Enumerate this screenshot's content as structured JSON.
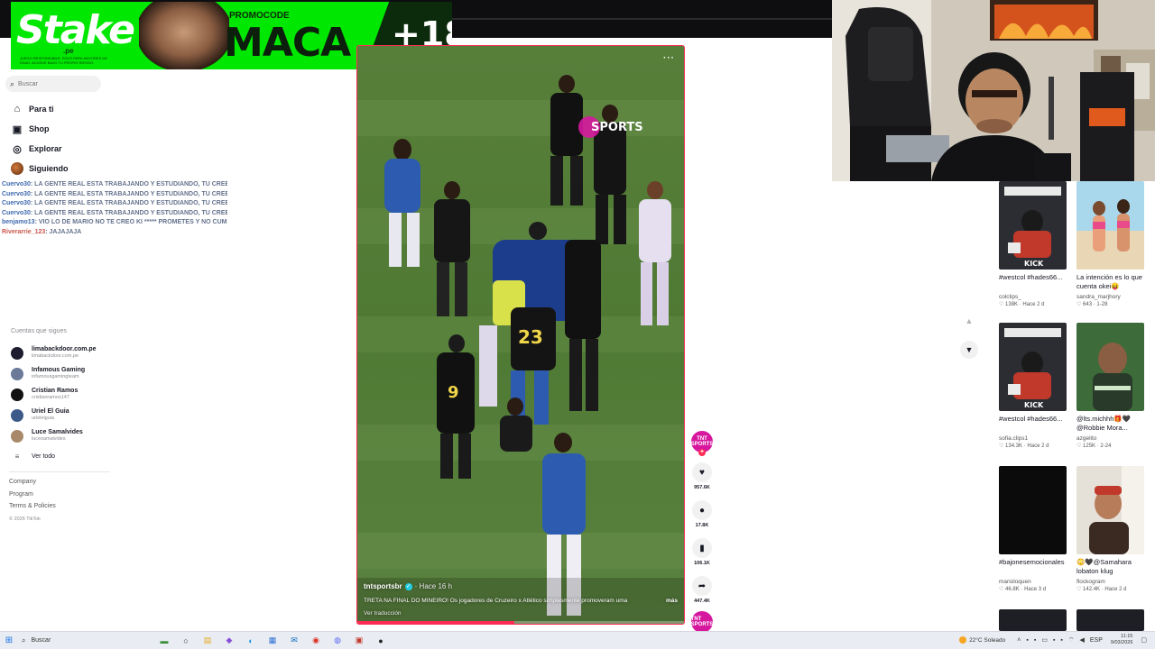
{
  "banner": {
    "logo": "Stake",
    "logo_sub": ".pe",
    "fineprint": "JUEGO RESPONSABLE. SOLO PARA MAYORES DE EDAD. ACCEDE BAJO TU PROPIO RIESGO.",
    "promo_label": "PROMOCODE",
    "promo_code": "MACA",
    "age": "+18"
  },
  "sidebar": {
    "search_placeholder": "Buscar",
    "nav": [
      {
        "label": "Para ti",
        "icon": "home-icon"
      },
      {
        "label": "Shop",
        "icon": "shop-bag-icon"
      },
      {
        "label": "Explorar",
        "icon": "compass-icon"
      },
      {
        "label": "Siguiendo",
        "icon": "avatar"
      }
    ],
    "following_title": "Cuentas que sigues",
    "following": [
      {
        "name": "limabackdoor.com.pe",
        "handle": "limabackdoor.com.pe",
        "color": "#1c1c2e"
      },
      {
        "name": "Infamous Gaming",
        "handle": "infamousgamingteam",
        "color": "#6b7a99"
      },
      {
        "name": "Cristian Ramos",
        "handle": "cristianramos147",
        "color": "#111111"
      },
      {
        "name": "Uriel El Guia",
        "handle": "urielelguia",
        "color": "#3b5a8a"
      },
      {
        "name": "Luce Samalvides",
        "handle": "lucesamalvides",
        "color": "#a88a6a"
      }
    ],
    "see_all": "Ver todo",
    "footer": [
      "Company",
      "Program",
      "Terms & Policies"
    ],
    "copyright": "© 2026 TikTok"
  },
  "chat": [
    {
      "user": "Cuervo30",
      "text": ": LA GENTE REAL ESTA TRABAJANDO Y ESTUDIANDO, TU CREES QUE VIVA DE TIKTOKEANDO CON TANTO TIEMPO LIBRE TE ESTA VIENDO AHORA",
      "red": false
    },
    {
      "user": "Cuervo30",
      "text": ": LA GENTE REAL ESTA TRABAJANDO Y ESTUDIANDO, TU CREES QUE VIVA DE TIKTOKEANDO CON TANTO TIEMPO LIBRE TE ESTA VIENDO AHORA",
      "red": false
    },
    {
      "user": "Cuervo30",
      "text": ": LA GENTE REAL ESTA TRABAJANDO Y ESTUDIANDO, TU CREES QUE VIVA DE TIKTOKEANDO CON TANTO TIEMPO LIBRE TE ESTA VIENDO AHORA",
      "red": false
    },
    {
      "user": "Cuervo30",
      "text": ": LA GENTE REAL ESTA TRABAJANDO Y ESTUDIANDO, TU CREES QUE VIVA DE TIKTOKEANDO CON TANTO TIEMPO LIBRE TE ESTA VIENDO AHORA",
      "red": false
    },
    {
      "user": "benjamo13",
      "text": ": VIO LO DE MARIO NO TE CREO KI ***** PROMETES Y NO CUMPLES",
      "red": false
    },
    {
      "user": "Riverarrie_123",
      "text": ": JAJAJAJA",
      "red": true
    }
  ],
  "video": {
    "channel_logo": "SPORTS",
    "author": "tntsportsbr",
    "time": "· Hace 16 h",
    "description": "TRETA NA FINAL DO MINEIRO! Os jogadores de Cruzeiro x Atlético simplesmente promoveram uma",
    "more": "más",
    "translate": "Ver traducción",
    "progress": 0.48
  },
  "actions": {
    "avatar_text": "TNT SPORTS",
    "likes": "957.6K",
    "comments": "17.8K",
    "saves": "106.1K",
    "shares": "447.4K"
  },
  "recommended": [
    {
      "title": "#westcol #hades66...",
      "author": "colclips_",
      "likes": "138K",
      "age": "Hace 2 d",
      "theme": "kick"
    },
    {
      "title": "La intención es lo que cuenta okei😝",
      "author": "sandra_marjhory",
      "likes": "643",
      "age": "1-28",
      "theme": "beach"
    },
    {
      "title": "#westcol #hades66...",
      "author": "sofia.clips1",
      "likes": "134.3K",
      "age": "Hace 2 d",
      "theme": "kick"
    },
    {
      "title": "@lts.michhh🎁🖤 @Robbie Mora...",
      "author": "azgelito",
      "likes": "125K",
      "age": "2-24",
      "theme": "green"
    },
    {
      "title": "#bajonesemocionales",
      "author": "marioloquen",
      "likes": "46.8K",
      "age": "Hace 3 d",
      "theme": "black"
    },
    {
      "title": "😳🖤@Samahara lobaton klug",
      "author": "flockogram",
      "likes": "142.4K",
      "age": "Hace 2 d",
      "theme": "room"
    }
  ],
  "taskbar": {
    "search": "Buscar",
    "weather": "22°C  Soleado",
    "lang": "ESP",
    "time": "11:15",
    "date": "9/03/2026"
  },
  "colors": {
    "accent": "#fe2c55",
    "stake_green": "#00e701",
    "tnt_pink": "#d6189f"
  }
}
